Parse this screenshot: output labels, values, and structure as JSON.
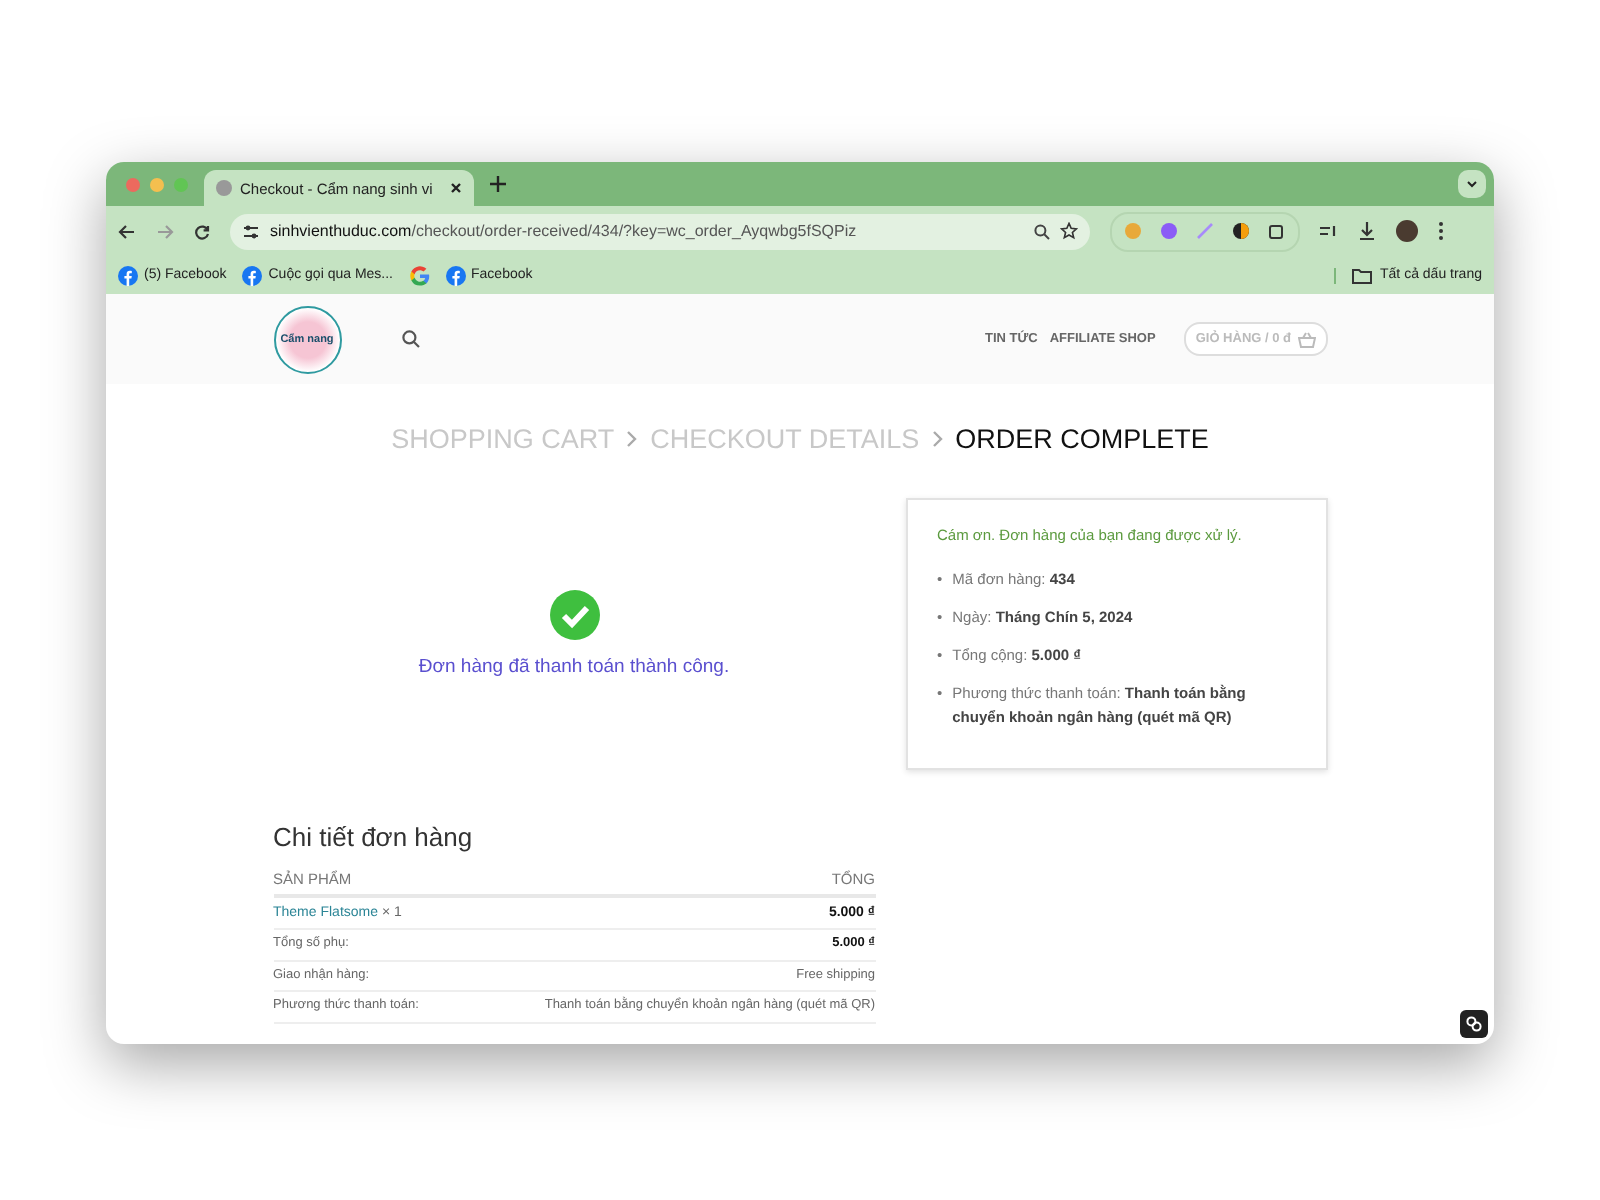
{
  "browser": {
    "tab_title": "Checkout - Cẩm nang sinh vi",
    "url_domain": "sinhvienthuduc.com",
    "url_path": "/checkout/order-received/434/?key=wc_order_Ayqwbg5fSQPiz",
    "bookmarks": [
      {
        "kind": "facebook",
        "label": "(5) Facebook"
      },
      {
        "kind": "facebook",
        "label": "Cuộc gọi qua Mes..."
      },
      {
        "kind": "google"
      },
      {
        "kind": "facebook",
        "label": "Facebook"
      }
    ],
    "all_bookmarks": "Tất cả dấu trang"
  },
  "site": {
    "logo_text": "Cẩm nang",
    "nav": [
      "TIN TỨC",
      "AFFILIATE SHOP"
    ],
    "cart": "GIỎ HÀNG / 0 đ"
  },
  "breadcrumb": [
    {
      "label": "SHOPPING CART",
      "selected": false
    },
    {
      "label": "CHECKOUT DETAILS",
      "selected": false
    },
    {
      "label": "ORDER COMPLETE",
      "selected": true
    }
  ],
  "success_message": "Đơn hàng đã thanh toán thành công.",
  "order_box": {
    "thanks": "Cám ơn. Đơn hàng của bạn đang được xử lý.",
    "items": [
      {
        "bullet": "•",
        "label": "Mã đơn hàng:",
        "value": "434"
      },
      {
        "bullet": "•",
        "label": "Ngày:",
        "value": "Tháng Chín 5, 2024"
      },
      {
        "bullet": "•",
        "label": "Tổng cộng:",
        "value": "5.000 ₫"
      },
      {
        "bullet": "•",
        "label": "Phương thức thanh toán:",
        "value": "Thanh toán bằng chuyển khoản ngân hàng (quét mã QR)"
      }
    ]
  },
  "order_details": {
    "title": "Chi tiết đơn hàng",
    "columns": [
      "SẢN PHẨM",
      "TỔNG"
    ],
    "rows": [
      {
        "kind": "product",
        "label": "Theme Flatsome",
        "quantity": "× 1",
        "value": "5.000 ₫"
      },
      {
        "kind": "summary",
        "label": "Tổng số phụ:",
        "value": "5.000 ₫"
      },
      {
        "kind": "summary",
        "label": "Giao nhận hàng:",
        "value": "Free shipping"
      },
      {
        "kind": "summary",
        "label": "Phương thức thanh toán:",
        "value": "Thanh toán bằng chuyển khoản ngân hàng (quét mã QR)"
      }
    ]
  }
}
